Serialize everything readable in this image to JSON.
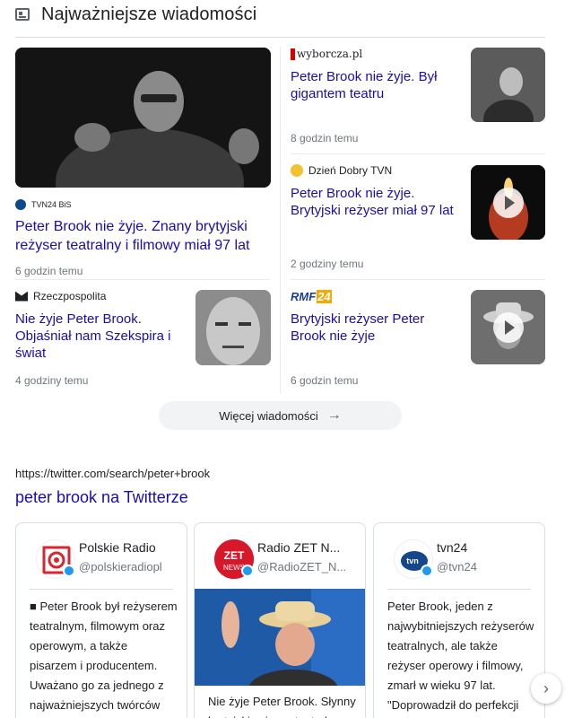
{
  "section": {
    "title": "Najważniejsze wiadomości",
    "more_label": "Więcej wiadomości"
  },
  "stories": [
    {
      "source": "TVN24 BiS",
      "headline": "Peter Brook nie żyje. Znany brytyjski reżyser teatralny i filmowy miał 97 lat",
      "time": "6 godzin temu"
    },
    {
      "source": "wyborcza.pl",
      "headline": "Peter Brook nie żyje. Był gigantem teatru",
      "time": "8 godzin temu"
    },
    {
      "source": "Dzień Dobry TVN",
      "headline": "Peter Brook nie żyje. Brytyjski reżyser miał 97 lat",
      "time": "2 godziny temu"
    },
    {
      "source": "Rzeczpospolita",
      "headline": "Nie żyje Peter Brook. Objaśniał nam Szekspira i świat",
      "time": "4 godziny temu"
    },
    {
      "source": "RMF 24",
      "headline": "Brytyjski reżyser Peter Brook nie żyje",
      "time": "6 godzin temu"
    }
  ],
  "twitter": {
    "url": "https://twitter.com/search/peter+brook",
    "title": "peter brook na Twitterze",
    "cards": [
      {
        "name": "Polskie Radio",
        "handle": "@polskieradiopl",
        "text": "■ Peter Brook był reżyserem teatralnym, filmowym oraz operowym, a także pisarzem i producentem. Uważano go za jednego z najważniejszych twórców"
      },
      {
        "name": "Radio ZET N...",
        "handle": "@RadioZET_N...",
        "text": "Nie żyje Peter Brook. Słynny brytyjski reżyser teatralny"
      },
      {
        "name": "tvn24",
        "handle": "@tvn24",
        "text": "Peter Brook, jeden z najwybitniejszych reżyserów teatralnych, ale także reżyser operowy i filmowy, zmarł w wieku 97 lat. \"Doprowadził do perfekcji sztukę wystawiania"
      }
    ]
  },
  "icons": {
    "header": "newspaper-icon",
    "next": "chevron-right-icon",
    "more": "arrow-right-icon"
  },
  "colors": {
    "link": "#1a0dab",
    "verified": "#1d9bf0"
  }
}
